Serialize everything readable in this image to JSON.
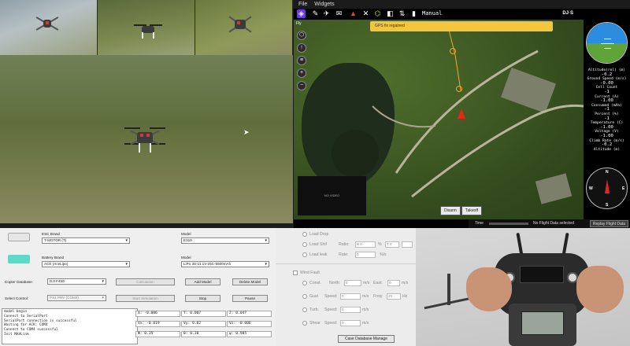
{
  "gcs": {
    "menu": [
      "File",
      "Widgets"
    ],
    "flight_mode": "Manual",
    "brand": "DJ·S",
    "toast": "GPS fix regained",
    "fly_label": "Fly",
    "video_label": "NO VIDEO",
    "map_buttons": [
      "Disarm",
      "Takeoff"
    ],
    "status_time": "Time",
    "status_msg": "No Flight Data selected",
    "replay_label": "Replay Flight Data",
    "instrument_values": [
      {
        "label": "Altitude(rel) (m)",
        "value": "-0.2"
      },
      {
        "label": "Ground Speed (m/s)",
        "value": "-0.00"
      },
      {
        "label": "Cell Count",
        "value": "-1"
      },
      {
        "label": "Current (A)",
        "value": "-1.00"
      },
      {
        "label": "Consumed (mAh)",
        "value": "-1"
      },
      {
        "label": "Percent (%)",
        "value": "-1"
      },
      {
        "label": "Temperature (C)",
        "value": "-1.00"
      },
      {
        "label": "Voltage (V)",
        "value": "-1.00"
      },
      {
        "label": "Climb Rate (m/s)",
        "value": "-0.2"
      },
      {
        "label": "Altitude (m)",
        "value": ""
      }
    ]
  },
  "config": {
    "esc_brand_label": "ESC Brand",
    "esc_brand_value": "T-MOTOR (T)",
    "model_label_1": "Model",
    "model_value_1": "E310",
    "battery_brand_label": "Battery Brand",
    "battery_brand_value": "ACE (AceLipo)",
    "model_label_2": "Model",
    "model_value_2": "LiPo 3S-11.1V-25C-5500mAh",
    "copter_db_label": "Copter Database:",
    "copter_db_value": "DJI F450",
    "calculation_btn": "Calculation",
    "add_model_btn": "Add Model",
    "delete_model_btn": "Delete Model",
    "select_control_label": "Select Control:",
    "select_control_value": "PX4 PRV (COM4)",
    "start_sim_btn": "Start Simulation",
    "stop_btn": "Stop",
    "pause_btn": "Pause",
    "log_lines": [
      "model begin",
      "Connect to SerialPort",
      "SerialPort connection is successful",
      "Waiting for ACK: COM4",
      "Connect to COM4 successful",
      "Init MAVLink"
    ],
    "state_grid": [
      [
        "X: -0.006",
        "Y: 0.007",
        "Z: 0.047"
      ],
      [
        "Vx: -0.019",
        "Vy: 0.02",
        "Vz: -0.006"
      ],
      [
        "Φ: 0.35",
        "θ: 0.38",
        "ψ: 0.985"
      ]
    ]
  },
  "fault": {
    "load_drop": "Load Drop",
    "load_shift": "Load Shif",
    "ratio_label": "Ratio:",
    "ratio_x": "X 0",
    "percent": "%",
    "t_label": "T 0",
    "load_leak": "Load leak",
    "rate_label": "Rate:",
    "rate_val": "0",
    "rate_unit": "%/s",
    "wind_fault": "Wind Fault",
    "const": "Const.",
    "north": "North:",
    "north_val": "0",
    "east": "East:",
    "east_val": "0",
    "ms": "m/s",
    "gust": "Gust",
    "speed": "Speed:",
    "gust_val": "0",
    "freq": "Freq:",
    "freq_val": "20",
    "freq_unit": "Hz",
    "turb": "Turb.",
    "turb_val": "0",
    "shear": "Shear",
    "shear_val": "0",
    "cdm_btn": "Case Database Manage"
  }
}
